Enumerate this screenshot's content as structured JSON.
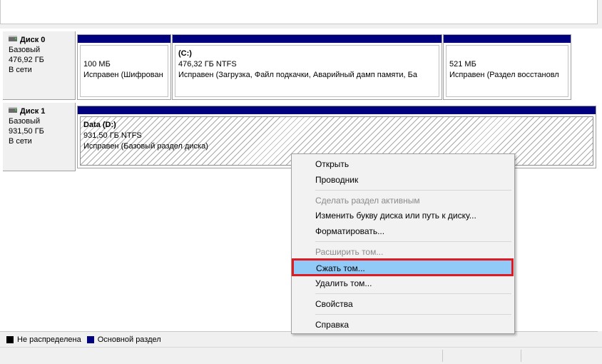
{
  "disks": [
    {
      "name": "Диск 0",
      "type": "Базовый",
      "size": "476,92 ГБ",
      "status": "В сети",
      "partitions": [
        {
          "title": "",
          "size": "100 МБ",
          "status": "Исправен (Шифрован"
        },
        {
          "title": "(C:)",
          "size": "476,32 ГБ NTFS",
          "status": "Исправен (Загрузка, Файл подкачки, Аварийный дамп памяти, Ба"
        },
        {
          "title": "",
          "size": "521 МБ",
          "status": "Исправен (Раздел восстановл"
        }
      ]
    },
    {
      "name": "Диск 1",
      "type": "Базовый",
      "size": "931,50 ГБ",
      "status": "В сети",
      "partitions": [
        {
          "title": "Data  (D:)",
          "size": "931,50 ГБ NTFS",
          "status": "Исправен (Базовый раздел диска)"
        }
      ]
    }
  ],
  "legend": {
    "unallocated": "Не распределена",
    "primary": "Основной раздел",
    "unallocated_color": "#000000",
    "primary_color": "#00007f"
  },
  "context_menu": {
    "items": [
      {
        "label": "Открыть",
        "enabled": true
      },
      {
        "label": "Проводник",
        "enabled": true
      },
      {
        "label": "Сделать раздел активным",
        "enabled": false
      },
      {
        "label": "Изменить букву диска или путь к диску...",
        "enabled": true
      },
      {
        "label": "Форматировать...",
        "enabled": true
      },
      {
        "label": "Расширить том...",
        "enabled": false
      },
      {
        "label": "Сжать том...",
        "enabled": true,
        "highlighted": true
      },
      {
        "label": "Удалить том...",
        "enabled": true
      },
      {
        "label": "Свойства",
        "enabled": true
      },
      {
        "label": "Справка",
        "enabled": true
      }
    ],
    "highlight_color": "#91c9f7",
    "annotation_color": "#e11920"
  }
}
